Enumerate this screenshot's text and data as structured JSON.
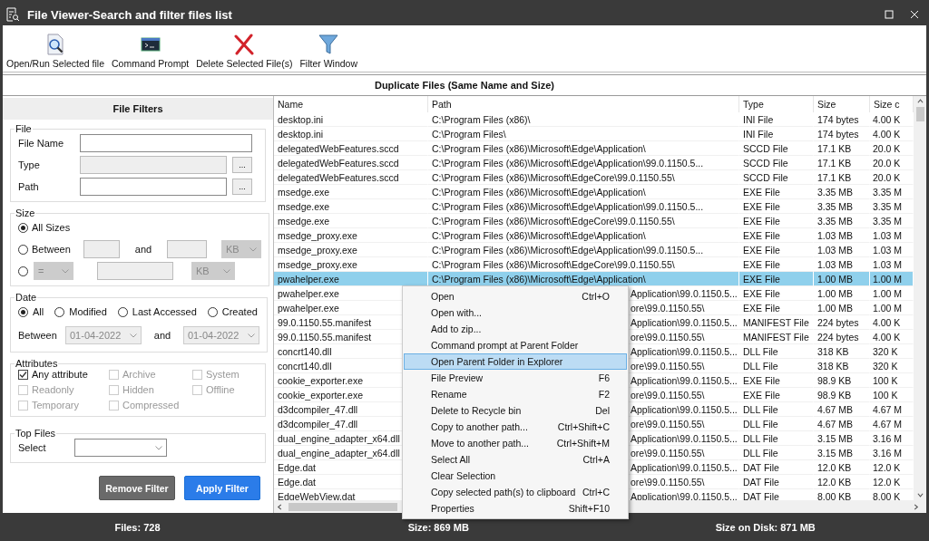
{
  "window": {
    "title": "File Viewer-Search and filter files list"
  },
  "toolbar": [
    {
      "label": "Open/Run Selected file",
      "kind": "open"
    },
    {
      "label": "Command Prompt",
      "kind": "terminal"
    },
    {
      "label": "Delete Selected File(s)",
      "kind": "delete"
    },
    {
      "label": "Filter Window",
      "kind": "filter"
    }
  ],
  "banner": "Duplicate Files (Same Name and Size)",
  "filters": {
    "title": "File Filters",
    "file": {
      "legend": "File",
      "fields": [
        {
          "label": "File Name",
          "disabled": false
        },
        {
          "label": "Type",
          "disabled": true,
          "browse": "..."
        },
        {
          "label": "Path",
          "disabled": false,
          "browse": "..."
        }
      ]
    },
    "size": {
      "legend": "Size",
      "options": [
        {
          "kind": "all",
          "label": "All Sizes",
          "selected": true
        },
        {
          "kind": "between",
          "label": "Between",
          "and": "and",
          "unit": "KB",
          "selected": false
        },
        {
          "kind": "compare",
          "operator": "=",
          "unit": "KB",
          "selected": false
        }
      ]
    },
    "date": {
      "legend": "Date",
      "options": [
        {
          "label": "All",
          "selected": true
        },
        {
          "label": "Modified",
          "selected": false
        },
        {
          "label": "Last Accessed",
          "selected": false
        },
        {
          "label": "Created",
          "selected": false
        }
      ],
      "between": "Between",
      "from": "01-04-2022",
      "and": "and",
      "to": "01-04-2022"
    },
    "attributes": {
      "legend": "Attributes",
      "items": [
        {
          "label": "Any attribute",
          "checked": true,
          "disabled": false
        },
        {
          "label": "Archive",
          "checked": false,
          "disabled": true
        },
        {
          "label": "System",
          "checked": false,
          "disabled": true
        },
        {
          "label": "Readonly",
          "checked": false,
          "disabled": true
        },
        {
          "label": "Hidden",
          "checked": false,
          "disabled": true
        },
        {
          "label": "Offline",
          "checked": false,
          "disabled": true
        },
        {
          "label": "Temporary",
          "checked": false,
          "disabled": true
        },
        {
          "label": "Compressed",
          "checked": false,
          "disabled": true
        }
      ]
    },
    "top_files": {
      "legend": "Top Files",
      "label": "Select"
    },
    "buttons": [
      {
        "label": "Remove Filter",
        "kind": "secondary"
      },
      {
        "label": "Apply Filter",
        "kind": "primary"
      }
    ]
  },
  "table": {
    "columns": [
      "Name",
      "Path",
      "Type",
      "Size",
      "Size c"
    ],
    "rows": [
      {
        "name": "desktop.ini",
        "path": "C:\\Program Files (x86)\\",
        "type": "INI File",
        "size": "174 bytes",
        "column_5": "4.00 K",
        "selected": false,
        "covered": false
      },
      {
        "name": "desktop.ini",
        "path": "C:\\Program Files\\",
        "type": "INI File",
        "size": "174 bytes",
        "column_5": "4.00 K",
        "selected": false,
        "covered": false
      },
      {
        "name": "delegatedWebFeatures.sccd",
        "path": "C:\\Program Files (x86)\\Microsoft\\Edge\\Application\\",
        "type": "SCCD File",
        "size": "17.1 KB",
        "column_5": "20.0 K",
        "selected": false,
        "covered": false
      },
      {
        "name": "delegatedWebFeatures.sccd",
        "path": "C:\\Program Files (x86)\\Microsoft\\Edge\\Application\\99.0.1150.5...",
        "type": "SCCD File",
        "size": "17.1 KB",
        "column_5": "20.0 K",
        "selected": false,
        "covered": false
      },
      {
        "name": "delegatedWebFeatures.sccd",
        "path": "C:\\Program Files (x86)\\Microsoft\\EdgeCore\\99.0.1150.55\\",
        "type": "SCCD File",
        "size": "17.1 KB",
        "column_5": "20.0 K",
        "selected": false,
        "covered": false
      },
      {
        "name": "msedge.exe",
        "path": "C:\\Program Files (x86)\\Microsoft\\Edge\\Application\\",
        "type": "EXE File",
        "size": "3.35 MB",
        "column_5": "3.35 M",
        "selected": false,
        "covered": false
      },
      {
        "name": "msedge.exe",
        "path": "C:\\Program Files (x86)\\Microsoft\\Edge\\Application\\99.0.1150.5...",
        "type": "EXE File",
        "size": "3.35 MB",
        "column_5": "3.35 M",
        "selected": false,
        "covered": false
      },
      {
        "name": "msedge.exe",
        "path": "C:\\Program Files (x86)\\Microsoft\\EdgeCore\\99.0.1150.55\\",
        "type": "EXE File",
        "size": "3.35 MB",
        "column_5": "3.35 M",
        "selected": false,
        "covered": false
      },
      {
        "name": "msedge_proxy.exe",
        "path": "C:\\Program Files (x86)\\Microsoft\\Edge\\Application\\",
        "type": "EXE File",
        "size": "1.03 MB",
        "column_5": "1.03 M",
        "selected": false,
        "covered": false
      },
      {
        "name": "msedge_proxy.exe",
        "path": "C:\\Program Files (x86)\\Microsoft\\Edge\\Application\\99.0.1150.5...",
        "type": "EXE File",
        "size": "1.03 MB",
        "column_5": "1.03 M",
        "selected": false,
        "covered": false
      },
      {
        "name": "msedge_proxy.exe",
        "path": "C:\\Program Files (x86)\\Microsoft\\EdgeCore\\99.0.1150.55\\",
        "type": "EXE File",
        "size": "1.03 MB",
        "column_5": "1.03 M",
        "selected": false,
        "covered": false
      },
      {
        "name": "pwahelper.exe",
        "path": "C:\\Program Files (x86)\\Microsoft\\Edge\\Application\\",
        "type": "EXE File",
        "size": "1.00 MB",
        "column_5": "1.00 M",
        "selected": true,
        "covered": false
      },
      {
        "name": "pwahelper.exe",
        "path": "Application\\99.0.1150.5...",
        "type": "EXE File",
        "size": "1.00 MB",
        "column_5": "1.00 M",
        "selected": false,
        "covered": true
      },
      {
        "name": "pwahelper.exe",
        "path": "ore\\99.0.1150.55\\",
        "type": "EXE File",
        "size": "1.00 MB",
        "column_5": "1.00 M",
        "selected": false,
        "covered": true
      },
      {
        "name": "99.0.1150.55.manifest",
        "path": "Application\\99.0.1150.5...",
        "type": "MANIFEST File",
        "size": "224 bytes",
        "column_5": "4.00 K",
        "selected": false,
        "covered": true
      },
      {
        "name": "99.0.1150.55.manifest",
        "path": "ore\\99.0.1150.55\\",
        "type": "MANIFEST File",
        "size": "224 bytes",
        "column_5": "4.00 K",
        "selected": false,
        "covered": true
      },
      {
        "name": "concrt140.dll",
        "path": "Application\\99.0.1150.5...",
        "type": "DLL File",
        "size": "318 KB",
        "column_5": "320 K",
        "selected": false,
        "covered": true
      },
      {
        "name": "concrt140.dll",
        "path": "ore\\99.0.1150.55\\",
        "type": "DLL File",
        "size": "318 KB",
        "column_5": "320 K",
        "selected": false,
        "covered": true
      },
      {
        "name": "cookie_exporter.exe",
        "path": "Application\\99.0.1150.5...",
        "type": "EXE File",
        "size": "98.9 KB",
        "column_5": "100 K",
        "selected": false,
        "covered": true
      },
      {
        "name": "cookie_exporter.exe",
        "path": "ore\\99.0.1150.55\\",
        "type": "EXE File",
        "size": "98.9 KB",
        "column_5": "100 K",
        "selected": false,
        "covered": true
      },
      {
        "name": "d3dcompiler_47.dll",
        "path": "Application\\99.0.1150.5...",
        "type": "DLL File",
        "size": "4.67 MB",
        "column_5": "4.67 M",
        "selected": false,
        "covered": true
      },
      {
        "name": "d3dcompiler_47.dll",
        "path": "ore\\99.0.1150.55\\",
        "type": "DLL File",
        "size": "4.67 MB",
        "column_5": "4.67 M",
        "selected": false,
        "covered": true
      },
      {
        "name": "dual_engine_adapter_x64.dll",
        "path": "Application\\99.0.1150.5...",
        "type": "DLL File",
        "size": "3.15 MB",
        "column_5": "3.16 M",
        "selected": false,
        "covered": true
      },
      {
        "name": "dual_engine_adapter_x64.dll",
        "path": "ore\\99.0.1150.55\\",
        "type": "DLL File",
        "size": "3.15 MB",
        "column_5": "3.16 M",
        "selected": false,
        "covered": true
      },
      {
        "name": "Edge.dat",
        "path": "Application\\99.0.1150.5...",
        "type": "DAT File",
        "size": "12.0 KB",
        "column_5": "12.0 K",
        "selected": false,
        "covered": true
      },
      {
        "name": "Edge.dat",
        "path": "ore\\99.0.1150.55\\",
        "type": "DAT File",
        "size": "12.0 KB",
        "column_5": "12.0 K",
        "selected": false,
        "covered": true
      },
      {
        "name": "EdgeWebView.dat",
        "path": "Application\\99.0.1150.5...",
        "type": "DAT File",
        "size": "8.00 KB",
        "column_5": "8.00 K",
        "selected": false,
        "covered": true
      }
    ]
  },
  "context_menu": {
    "items": [
      {
        "label": "Open",
        "shortcut": "Ctrl+O",
        "selected": false
      },
      {
        "label": "Open with...",
        "selected": false
      },
      {
        "label": "Add to zip...",
        "selected": false
      },
      {
        "label": "Command prompt at Parent Folder",
        "selected": false
      },
      {
        "label": "Open Parent Folder in Explorer",
        "selected": true
      },
      {
        "label": "File Preview",
        "shortcut": "F6",
        "selected": false
      },
      {
        "label": "Rename",
        "shortcut": "F2",
        "selected": false
      },
      {
        "label": "Delete to Recycle bin",
        "shortcut": "Del",
        "selected": false
      },
      {
        "label": "Copy to another path...",
        "shortcut": "Ctrl+Shift+C",
        "selected": false
      },
      {
        "label": "Move to another path...",
        "shortcut": "Ctrl+Shift+M",
        "selected": false
      },
      {
        "label": "Select All",
        "shortcut": "Ctrl+A",
        "selected": false
      },
      {
        "label": "Clear Selection",
        "selected": false
      },
      {
        "label": "Copy selected path(s) to clipboard",
        "shortcut": "Ctrl+C",
        "selected": false
      },
      {
        "label": "Properties",
        "shortcut": "Shift+F10",
        "selected": false
      }
    ]
  },
  "status_bar": [
    "Files: 728",
    "Size: 869 MB",
    "Size on Disk: 871 MB"
  ]
}
